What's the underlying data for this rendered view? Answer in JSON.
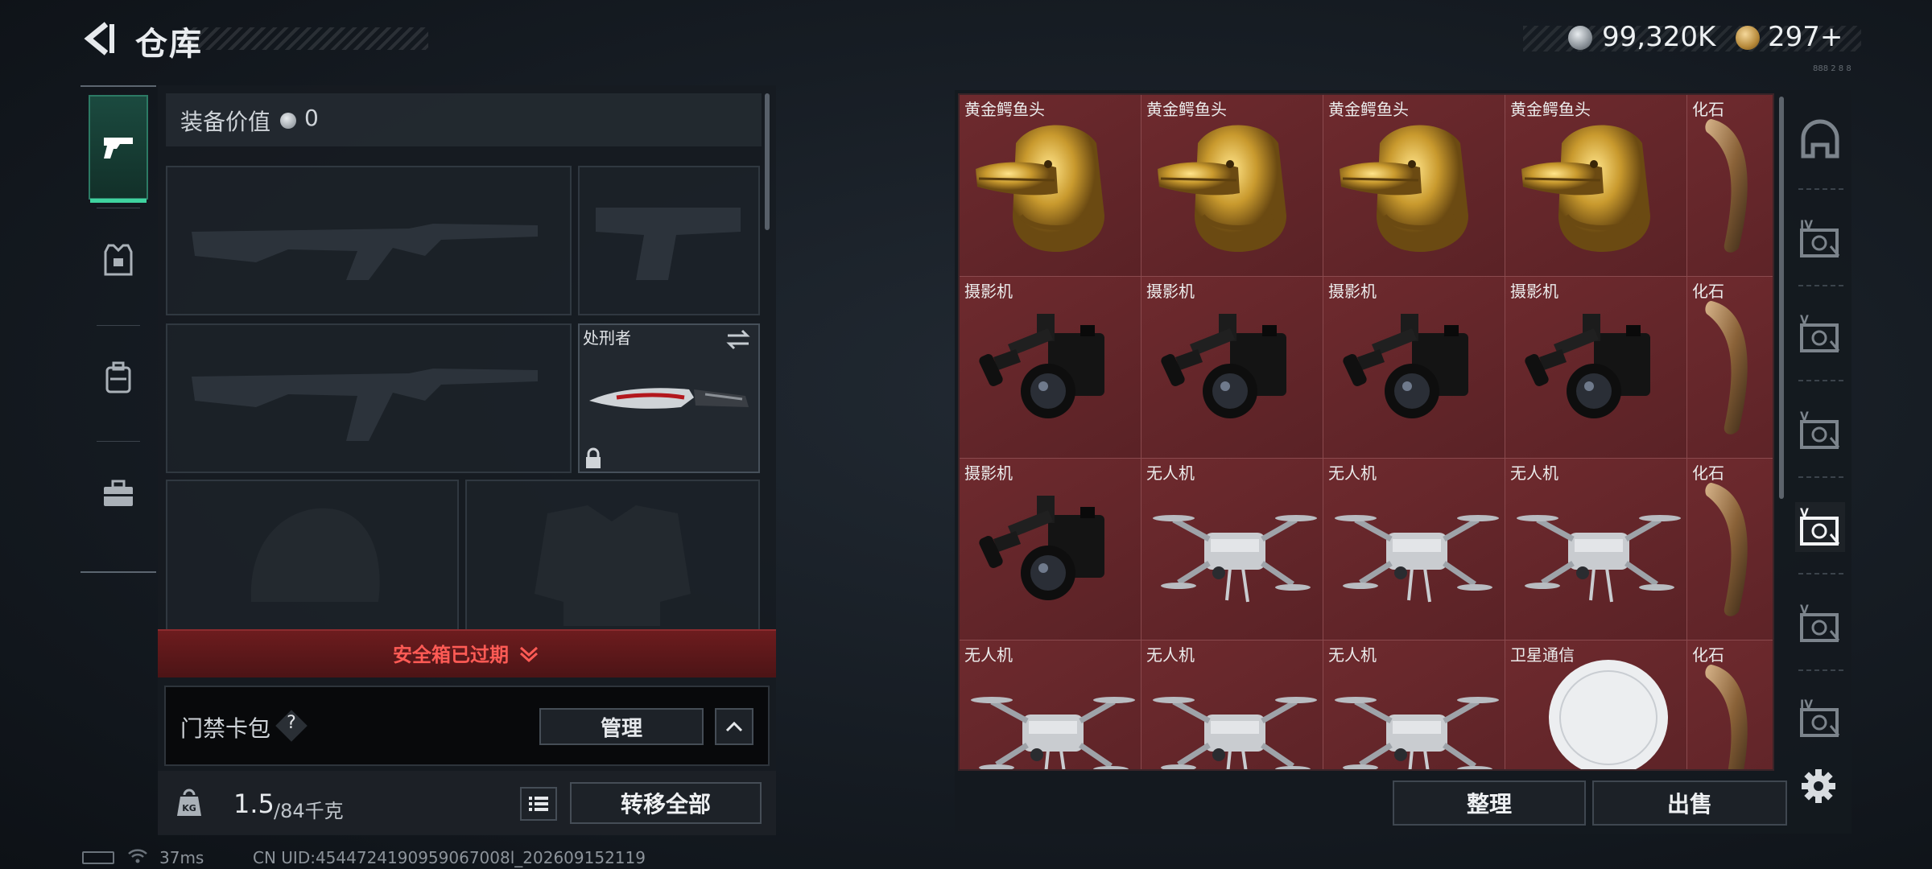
{
  "header": {
    "title": "仓库",
    "money": "99,320K",
    "points": "297+",
    "corner_text": "888 2 8 8",
    "money_icon": "silver-coin-icon",
    "points_icon": "gold-coin-icon"
  },
  "left_tabs": [
    {
      "name": "weapon",
      "icon": "pistol-icon",
      "active": true
    },
    {
      "name": "armor",
      "icon": "vest-icon",
      "active": false
    },
    {
      "name": "backpack",
      "icon": "backpack-icon",
      "active": false
    },
    {
      "name": "case",
      "icon": "briefcase-icon",
      "active": false
    }
  ],
  "equipment": {
    "value_label": "装备价值",
    "value": "0",
    "melee_name": "处刑者",
    "melee_locked": true
  },
  "safe_box": {
    "expired_text": "安全箱已过期"
  },
  "keycard": {
    "label": "门禁卡包",
    "help": "?",
    "manage_label": "管理"
  },
  "weight": {
    "current": "1.5",
    "max": "/84千克",
    "icon_text": "KG",
    "transfer_label": "转移全部"
  },
  "status": {
    "ping": "37ms",
    "uid": "CN UID:4544724190959067008l_202609152119"
  },
  "inventory": {
    "columns": 5,
    "items": [
      {
        "name": "黄金鳄鱼头",
        "kind": "croc"
      },
      {
        "name": "黄金鳄鱼头",
        "kind": "croc"
      },
      {
        "name": "黄金鳄鱼头",
        "kind": "croc"
      },
      {
        "name": "黄金鳄鱼头",
        "kind": "croc"
      },
      {
        "name": "化石",
        "kind": "fossil"
      },
      {
        "name": "摄影机",
        "kind": "camera"
      },
      {
        "name": "摄影机",
        "kind": "camera"
      },
      {
        "name": "摄影机",
        "kind": "camera"
      },
      {
        "name": "摄影机",
        "kind": "camera"
      },
      {
        "name": "化石",
        "kind": "fossil"
      },
      {
        "name": "摄影机",
        "kind": "camera"
      },
      {
        "name": "无人机",
        "kind": "drone"
      },
      {
        "name": "无人机",
        "kind": "drone"
      },
      {
        "name": "无人机",
        "kind": "drone"
      },
      {
        "name": "化石",
        "kind": "fossil"
      },
      {
        "name": "无人机",
        "kind": "drone"
      },
      {
        "name": "无人机",
        "kind": "drone"
      },
      {
        "name": "无人机",
        "kind": "drone"
      },
      {
        "name": "卫星通信",
        "kind": "satellite"
      },
      {
        "name": "化石",
        "kind": "fossil"
      }
    ]
  },
  "right_tabs": [
    {
      "name": "helmet-tab",
      "label": ""
    },
    {
      "name": "case-iv-tab",
      "label": "IV"
    },
    {
      "name": "case-v-tab-1",
      "label": "V"
    },
    {
      "name": "case-v-tab-2",
      "label": "V"
    },
    {
      "name": "case-v-tab-active",
      "label": "V"
    },
    {
      "name": "case-v-tab-3",
      "label": "V"
    },
    {
      "name": "case-iv-tab-2",
      "label": "IV"
    }
  ],
  "actions": {
    "sort_label": "整理",
    "sell_label": "出售"
  },
  "colors": {
    "accent_green": "#3fd39f",
    "expired_red": "#ff5b55",
    "cell_bg": "#6e2a2e"
  }
}
